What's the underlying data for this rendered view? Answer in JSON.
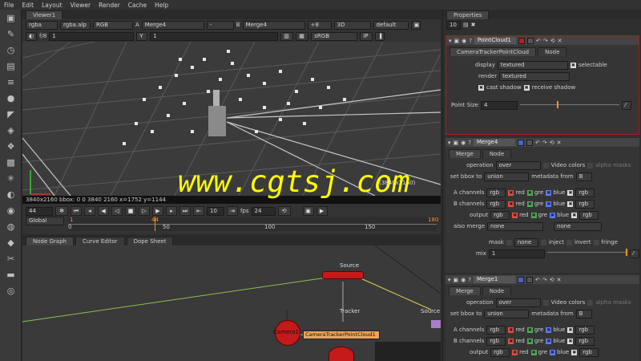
{
  "menubar": {
    "items": [
      "File",
      "Edit",
      "Layout",
      "Viewer",
      "Render",
      "Cache",
      "Help"
    ]
  },
  "viewer": {
    "tab": "Viewer1",
    "row1": {
      "channels": "rgba",
      "alpha": "rgba.alp",
      "colorspace": "RGB",
      "a_label": "A",
      "a_input": "Merge4",
      "dash": "-",
      "b_label": "B",
      "b_input": "Merge4",
      "proxy": "÷8",
      "view_mode": "3D",
      "camera": "default"
    },
    "row2": {
      "fstop": "f/8",
      "gain": "1",
      "y_label": "Y",
      "gamma": "1",
      "lut": "sRGB",
      "ip": "IP"
    },
    "info": "3840x2160  bbox: 0 0 3840 2160  x=1752 y=1144",
    "bbox_label": "(3840x2160)",
    "transport": {
      "frame": "44",
      "step": "10",
      "fps_label": "fps",
      "fps": "24",
      "scope": "Global",
      "ruler": [
        "0",
        "50",
        "100",
        "150"
      ],
      "ruler_end": "180",
      "ruler_start": "1",
      "cursor": "44"
    }
  },
  "nodegraph": {
    "tabs": [
      "Node Graph",
      "Curve Editor",
      "Dope Sheet"
    ],
    "nodes": {
      "source": "Source",
      "tracker": "Tracker",
      "camera": "Camera1",
      "pointcloud": "CameraTrackerPointCloud1",
      "source2": "Source"
    }
  },
  "properties": {
    "title": "Properties",
    "count": "10",
    "panel1": {
      "name": "PointCloud1",
      "tabs": [
        "CameraTrackerPointCloud",
        "Node"
      ],
      "display_label": "display",
      "display_value": "textured",
      "selectable": "selectable",
      "render_label": "render",
      "render_value": "textured",
      "cast_shadow": "cast shadow",
      "receive_shadow": "receive shadow",
      "point_size_label": "Point Size",
      "point_size": "4",
      "slider_ticks": [
        "2",
        "4",
        "6",
        "8",
        "10"
      ]
    },
    "panel2": {
      "name": "Merge4",
      "tabs": [
        "Merge",
        "Node"
      ],
      "operation_label": "operation",
      "operation": "over",
      "video_colors": "Video colors",
      "alpha_masks": "alpha masks",
      "bbox_label": "set bbox to",
      "bbox": "union",
      "metadata_label": "metadata from",
      "metadata": "B",
      "a_channels": "A channels",
      "b_channels": "B channels",
      "output": "output",
      "rgb": "rgb",
      "red": "red",
      "green": "gre",
      "blue": "blue",
      "also_merge": "also merge",
      "none": "none",
      "mask_label": "mask",
      "inject": "inject",
      "invert": "invert",
      "fringe": "fringe",
      "mix_label": "mix",
      "mix": "1",
      "mix_ticks": [
        "0",
        "0.2",
        "0.4",
        "0.6",
        "0.8",
        "1"
      ]
    },
    "panel3": {
      "name": "Merge1",
      "tabs": [
        "Merge",
        "Node"
      ],
      "operation_label": "operation",
      "operation": "over",
      "video_colors": "Video colors",
      "alpha_masks": "alpha masks",
      "bbox_label": "set bbox to",
      "bbox": "union",
      "metadata_label": "metadata from",
      "metadata": "B",
      "a_channels": "A channels",
      "b_channels": "B channels",
      "output": "output",
      "rgb": "rgb",
      "red": "red",
      "green": "gre",
      "blue": "blue"
    }
  },
  "watermark": "www.cgtsj.com",
  "colors": {
    "accent": "#f7941d",
    "node_red": "#c41a1a",
    "pointcloud_border": "#b01818",
    "watermark": "#ffff00"
  }
}
